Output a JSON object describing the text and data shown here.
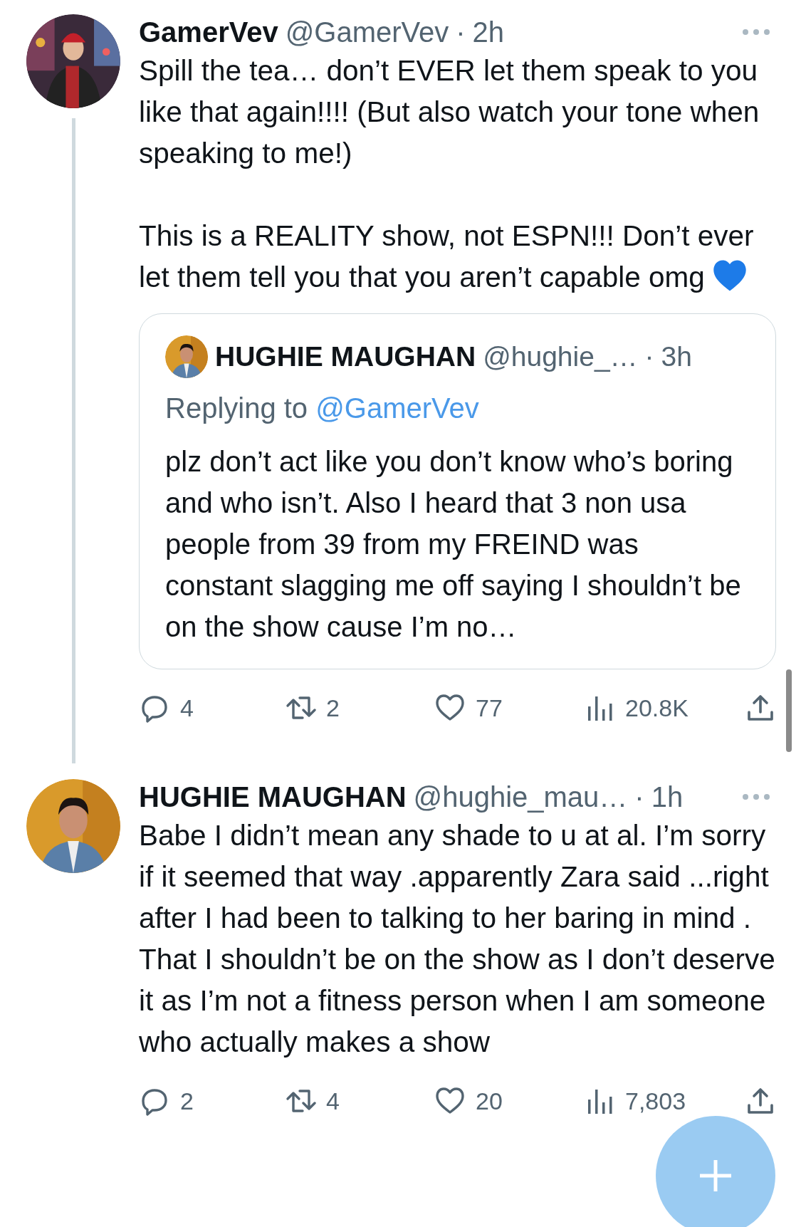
{
  "tweets": [
    {
      "name": "GamerVev",
      "handle": "@GamerVev",
      "separator": "·",
      "time": "2h",
      "thread_line": true,
      "paragraphs": [
        "Spill the tea… don’t EVER let them speak to you like that again!!!! (But also watch your tone when speaking to me!)",
        "This is a REALITY show, not ESPN!!! Don’t ever let them tell you that you aren’t capable omg"
      ],
      "trailing_emoji": {
        "kind": "heart",
        "color": "#1d7be8"
      },
      "quote": {
        "name": "HUGHIE MAUGHAN",
        "handle": "@hughie_…",
        "separator": "·",
        "time": "3h",
        "replying_label": "Replying to",
        "replying_to": "@GamerVev",
        "text": "plz don’t act like you don’t know who’s boring and who isn’t. Also I heard that 3 non usa people from 39 from my FREIND was constant slagging me off saying I shouldn’t be on the show cause I’m no…"
      },
      "actions": [
        {
          "kind": "reply",
          "count": "4"
        },
        {
          "kind": "retweet",
          "count": "2"
        },
        {
          "kind": "like",
          "count": "77"
        },
        {
          "kind": "views",
          "count": "20.8K"
        },
        {
          "kind": "share"
        }
      ]
    },
    {
      "name": "HUGHIE MAUGHAN",
      "handle": "@hughie_mau…",
      "separator": "·",
      "time": "1h",
      "thread_line": false,
      "paragraphs": [
        "Babe I didn’t mean any shade to u at al. I’m sorry if it seemed that way .apparently Zara said ...right after I had been to talking to her baring in mind . That I shouldn’t be on the show as I don’t deserve it as I’m not a fitness person when I am someone who actually makes a show"
      ],
      "actions": [
        {
          "kind": "reply",
          "count": "2"
        },
        {
          "kind": "retweet",
          "count": "4"
        },
        {
          "kind": "like",
          "count": "20"
        },
        {
          "kind": "views",
          "count": "7,803"
        },
        {
          "kind": "share"
        }
      ]
    }
  ]
}
